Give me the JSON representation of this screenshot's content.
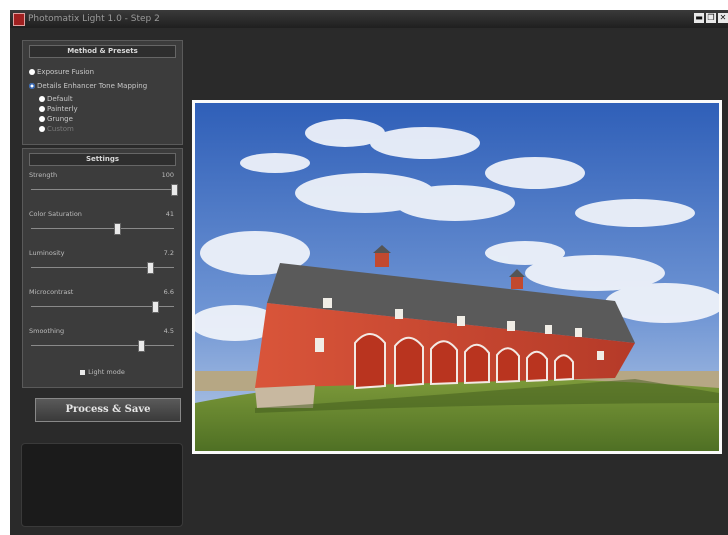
{
  "window": {
    "title": "Photomatix Light 1.0 - Step 2",
    "buttons": [
      "▬",
      "❐",
      "✕"
    ]
  },
  "method_panel": {
    "header": "Method & Presets",
    "options": [
      {
        "label": "Exposure Fusion",
        "selected": false
      },
      {
        "label": "Details Enhancer Tone Mapping",
        "selected": true
      }
    ],
    "presets": [
      "Default",
      "Painterly",
      "Grunge",
      "Custom"
    ]
  },
  "settings_panel": {
    "header": "Settings",
    "sliders": [
      {
        "label": "Strength",
        "value": "100",
        "fraction": 1.0
      },
      {
        "label": "Color Saturation",
        "value": "41",
        "fraction": 0.6
      },
      {
        "label": "Luminosity",
        "value": "7.2",
        "fraction": 0.83
      },
      {
        "label": "Microcontrast",
        "value": "6.6",
        "fraction": 0.87
      },
      {
        "label": "Smoothing",
        "value": "4.5",
        "fraction": 0.77
      }
    ],
    "checkbox_label": "Light mode"
  },
  "process_button": "Process & Save",
  "colors": {
    "window_bg": "#2a2a2a",
    "panel_bg": "#3c3c3c",
    "barn_red": "#c9432d",
    "sky_blue": "#3e6fc2"
  },
  "icons": {
    "app": "photomatix-app-icon"
  }
}
